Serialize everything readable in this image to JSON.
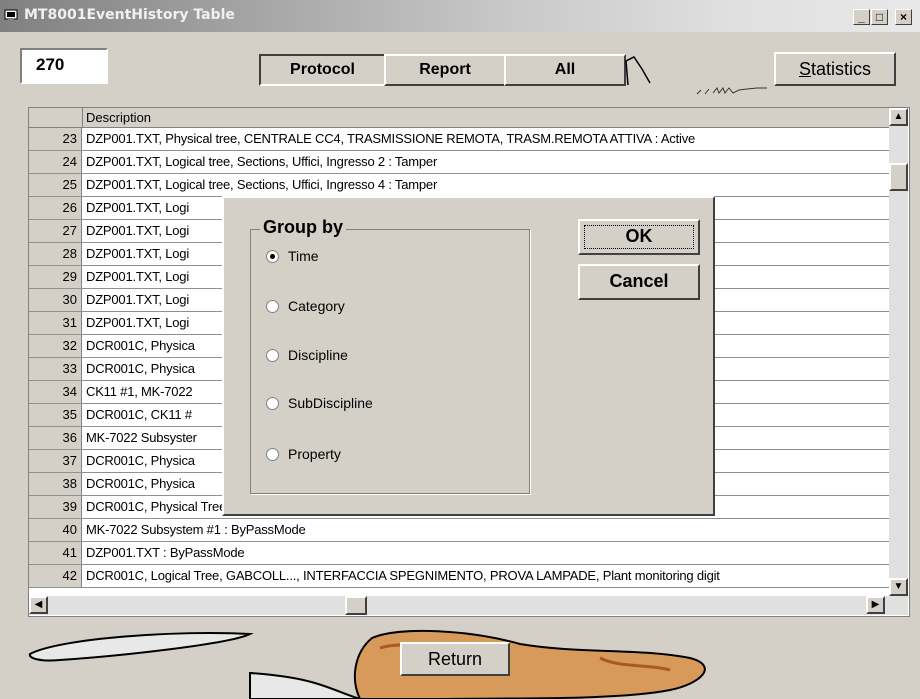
{
  "window": {
    "title": "MT8001EventHistory Table",
    "controls": [
      "_",
      "□",
      "×"
    ]
  },
  "toolbar": {
    "count": "270",
    "tabs": [
      "Protocol",
      "Report",
      "All"
    ],
    "selected_tab": "Protocol",
    "statistics_label": "Statistics",
    "statistics_hotkey": "S"
  },
  "table": {
    "header": "Description",
    "rows": [
      {
        "n": "23",
        "text": "DZP001.TXT, Physical tree, CENTRALE CC4, TRASMISSIONE REMOTA, TRASM.REMOTA ATTIVA : Active"
      },
      {
        "n": "24",
        "text": "DZP001.TXT, Logical tree, Sections, Uffici, Ingresso 2 : Tamper"
      },
      {
        "n": "25",
        "text": "DZP001.TXT, Logical tree, Sections, Uffici, Ingresso 4 : Tamper"
      },
      {
        "n": "26",
        "text": "DZP001.TXT, Logi"
      },
      {
        "n": "27",
        "text": "DZP001.TXT, Logi"
      },
      {
        "n": "28",
        "text": "DZP001.TXT, Logi"
      },
      {
        "n": "29",
        "text": "DZP001.TXT, Logi"
      },
      {
        "n": "30",
        "text": "DZP001.TXT, Logi"
      },
      {
        "n": "31",
        "text": "DZP001.TXT, Logi"
      },
      {
        "n": "32",
        "text": "DCR001C, Physica"
      },
      {
        "n": "33",
        "text": "DCR001C, Physica"
      },
      {
        "n": "34",
        "text": "CK11 #1, MK-7022"
      },
      {
        "n": "35",
        "text": "DCR001C, CK11 #"
      },
      {
        "n": "36",
        "text": "MK-7022 Subsyster"
      },
      {
        "n": "37",
        "text": "DCR001C, Physica"
      },
      {
        "n": "38",
        "text": "DCR001C, Physica"
      },
      {
        "n": "39",
        "text": "DCR001C, Physical Tree, stazione CBus nr.1, sorveglianza alimentazione : Faulty"
      },
      {
        "n": "40",
        "text": "MK-7022 Subsystem #1 : ByPassMode"
      },
      {
        "n": "41",
        "text": "DZP001.TXT : ByPassMode"
      },
      {
        "n": "42",
        "text": "DCR001C, Logical Tree, GABCOLL..., INTERFACCIA SPEGNIMENTO, PROVA LAMPADE, Plant monitoring digit"
      }
    ]
  },
  "dialog": {
    "group_title": "Group by",
    "options": [
      "Time",
      "Category",
      "Discipline",
      "SubDiscipline",
      "Property"
    ],
    "selected": "Time",
    "ok_label": "OK",
    "cancel_label": "Cancel"
  },
  "footer": {
    "return_label": "Return"
  }
}
